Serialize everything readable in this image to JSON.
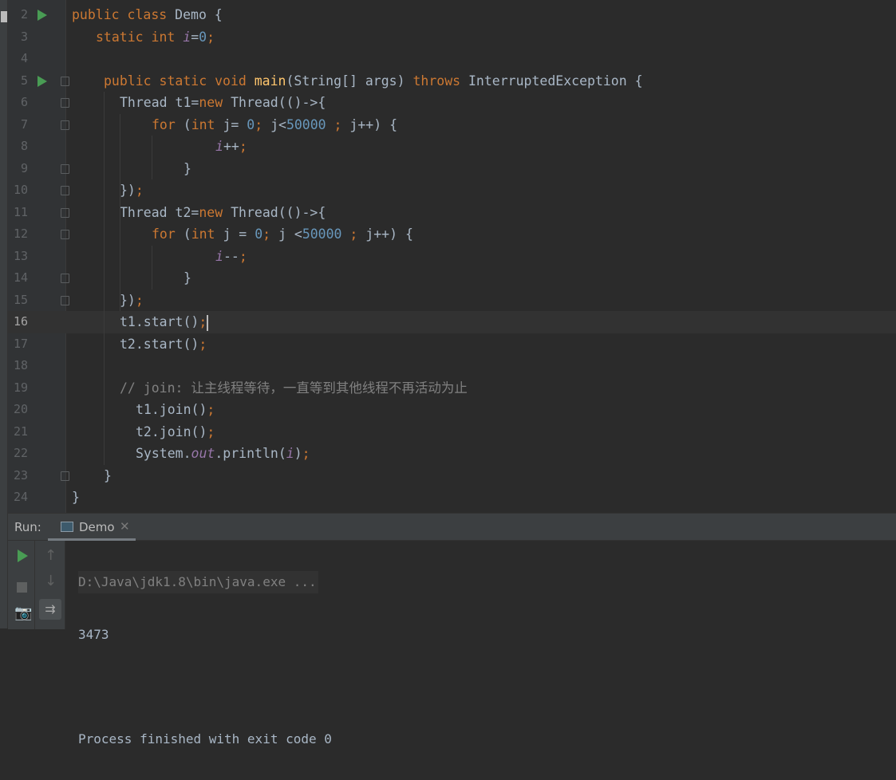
{
  "editor": {
    "current_line": 16,
    "lines": [
      {
        "n": "2",
        "run": true,
        "fold": false,
        "indent": 0,
        "t": [
          [
            "kw",
            "public class "
          ],
          [
            "tx",
            "Demo {"
          ]
        ]
      },
      {
        "n": "3",
        "indent": 3,
        "t": [
          [
            "kw",
            "static int "
          ],
          [
            "fld",
            "i"
          ],
          [
            "tx",
            "="
          ],
          [
            "num",
            "0"
          ],
          [
            "kw",
            ";"
          ]
        ]
      },
      {
        "n": "4",
        "indent": 0,
        "t": []
      },
      {
        "n": "5",
        "run": true,
        "fold": true,
        "indent": 4,
        "t": [
          [
            "kw",
            "public static void "
          ],
          [
            "fn",
            "main"
          ],
          [
            "tx",
            "(String[] args) "
          ],
          [
            "kw",
            "throws "
          ],
          [
            "tx",
            "InterruptedException {"
          ]
        ]
      },
      {
        "n": "6",
        "fold": true,
        "indent": 6,
        "t": [
          [
            "tx",
            "Thread t1="
          ],
          [
            "kw",
            "new "
          ],
          [
            "tx",
            "Thread(()->{"
          ]
        ]
      },
      {
        "n": "7",
        "fold": true,
        "indent": 10,
        "t": [
          [
            "kw",
            "for "
          ],
          [
            "tx",
            "("
          ],
          [
            "kw",
            "int "
          ],
          [
            "tx",
            "j= "
          ],
          [
            "num",
            "0"
          ],
          [
            "kw",
            "; "
          ],
          [
            "tx",
            "j<"
          ],
          [
            "num",
            "50000 "
          ],
          [
            "kw",
            "; "
          ],
          [
            "tx",
            "j++) {"
          ]
        ]
      },
      {
        "n": "8",
        "indent": 18,
        "t": [
          [
            "fld",
            "i"
          ],
          [
            "tx",
            "++"
          ],
          [
            "kw",
            ";"
          ]
        ]
      },
      {
        "n": "9",
        "fold": true,
        "indent": 14,
        "t": [
          [
            "tx",
            "}"
          ]
        ]
      },
      {
        "n": "10",
        "fold": true,
        "indent": 6,
        "t": [
          [
            "tx",
            "})"
          ],
          [
            "kw",
            ";"
          ]
        ]
      },
      {
        "n": "11",
        "fold": true,
        "indent": 6,
        "t": [
          [
            "tx",
            "Thread t2="
          ],
          [
            "kw",
            "new "
          ],
          [
            "tx",
            "Thread(()->{"
          ]
        ]
      },
      {
        "n": "12",
        "fold": true,
        "indent": 10,
        "t": [
          [
            "kw",
            "for "
          ],
          [
            "tx",
            "("
          ],
          [
            "kw",
            "int "
          ],
          [
            "tx",
            "j = "
          ],
          [
            "num",
            "0"
          ],
          [
            "kw",
            "; "
          ],
          [
            "tx",
            "j <"
          ],
          [
            "num",
            "50000 "
          ],
          [
            "kw",
            "; "
          ],
          [
            "tx",
            "j++) {"
          ]
        ]
      },
      {
        "n": "13",
        "indent": 18,
        "t": [
          [
            "fld",
            "i"
          ],
          [
            "tx",
            "--"
          ],
          [
            "kw",
            ";"
          ]
        ]
      },
      {
        "n": "14",
        "fold": true,
        "indent": 14,
        "t": [
          [
            "tx",
            "}"
          ]
        ]
      },
      {
        "n": "15",
        "fold": true,
        "indent": 6,
        "t": [
          [
            "tx",
            "})"
          ],
          [
            "kw",
            ";"
          ]
        ]
      },
      {
        "n": "16",
        "indent": 6,
        "caret": true,
        "t": [
          [
            "tx",
            "t1.start()"
          ],
          [
            "kw",
            ";"
          ]
        ]
      },
      {
        "n": "17",
        "indent": 6,
        "t": [
          [
            "tx",
            "t2.start()"
          ],
          [
            "kw",
            ";"
          ]
        ]
      },
      {
        "n": "18",
        "indent": 0,
        "t": []
      },
      {
        "n": "19",
        "indent": 6,
        "t": [
          [
            "cm",
            "// join: 让主线程等待，一直等到其他线程不再活动为止"
          ]
        ]
      },
      {
        "n": "20",
        "indent": 8,
        "t": [
          [
            "tx",
            "t1.join()"
          ],
          [
            "kw",
            ";"
          ]
        ]
      },
      {
        "n": "21",
        "indent": 8,
        "t": [
          [
            "tx",
            "t2.join()"
          ],
          [
            "kw",
            ";"
          ]
        ]
      },
      {
        "n": "22",
        "indent": 8,
        "t": [
          [
            "tx",
            "System."
          ],
          [
            "fld",
            "out"
          ],
          [
            "tx",
            ".println("
          ],
          [
            "fld",
            "i"
          ],
          [
            "tx",
            ")"
          ],
          [
            "kw",
            ";"
          ]
        ]
      },
      {
        "n": "23",
        "fold": true,
        "indent": 4,
        "t": [
          [
            "tx",
            "}"
          ]
        ]
      },
      {
        "n": "24",
        "indent": 0,
        "t": [
          [
            "tx",
            "}"
          ]
        ]
      }
    ]
  },
  "run_panel": {
    "label": "Run:",
    "tab": "Demo",
    "output": [
      "D:\\Java\\jdk1.8\\bin\\java.exe ...",
      "3473",
      "",
      "Process finished with exit code 0"
    ]
  },
  "colors": {
    "keyword": "#cc7832",
    "number": "#6897bb",
    "field": "#9876aa",
    "method": "#ffc66d",
    "comment": "#808080",
    "run_icon": "#499c54"
  }
}
